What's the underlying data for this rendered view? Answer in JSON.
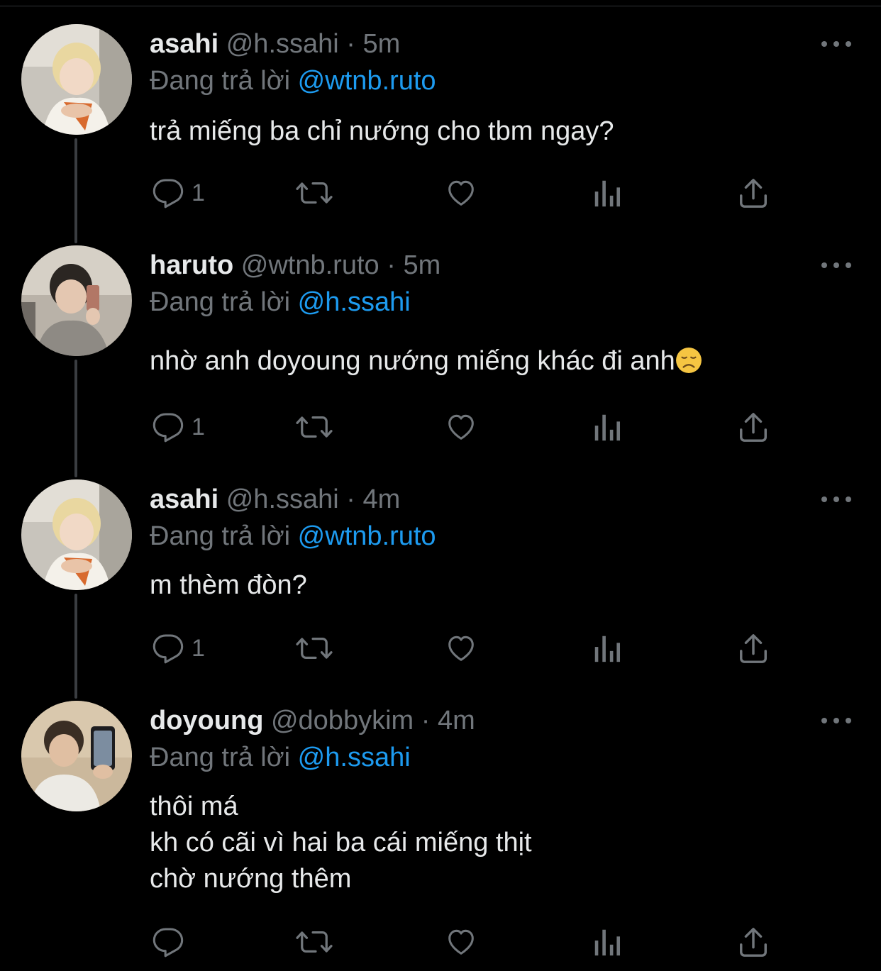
{
  "reply_prefix": "Đang trả lời",
  "separator": "·",
  "colors": {
    "background": "#000000",
    "text": "#e7e9ea",
    "muted": "#71767b",
    "accent": "#1d9bf0"
  },
  "tweets": [
    {
      "name": "asahi",
      "handle": "@h.ssahi",
      "time": "5m",
      "replying_to": "@wtnb.ruto",
      "lines": [
        "trả miếng ba chỉ nướng cho tbm ngay?"
      ],
      "reply_count": "1",
      "avatar_icon": "avatar-photo-blond"
    },
    {
      "name": "haruto",
      "handle": "@wtnb.ruto",
      "time": "5m",
      "replying_to": "@h.ssahi",
      "lines": [
        "nhờ anh doyoung nướng miếng khác đi anh"
      ],
      "emoji": "disappointed-face",
      "reply_count": "1",
      "avatar_icon": "avatar-photo-mirror-selfie"
    },
    {
      "name": "asahi",
      "handle": "@h.ssahi",
      "time": "4m",
      "replying_to": "@wtnb.ruto",
      "lines": [
        "m thèm đòn?"
      ],
      "reply_count": "1",
      "avatar_icon": "avatar-photo-blond"
    },
    {
      "name": "doyoung",
      "handle": "@dobbykim",
      "time": "4m",
      "replying_to": "@h.ssahi",
      "lines": [
        "thôi má",
        "kh có cãi vì hai ba cái miếng thịt",
        "chờ nướng thêm"
      ],
      "reply_count": "",
      "avatar_icon": "avatar-photo-phone"
    }
  ],
  "action_icons": [
    "reply-icon",
    "retweet-icon",
    "like-icon",
    "views-icon",
    "share-icon"
  ]
}
